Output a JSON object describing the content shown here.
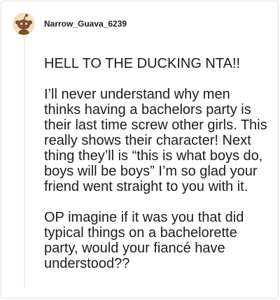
{
  "comment": {
    "username": "Narrow_Guava_6239",
    "avatar_icon": "reddit-snoo-avatar-icon",
    "paragraphs": [
      "HELL TO THE DUCKING NTA!!",
      "I’ll never understand why men thinks having a bachelors party is their last time screw other girls. This really shows their character! Next thing they’ll is “this is what boys do, boys will be boys” I’m so glad your friend went straight to you with it.",
      "OP imagine if it was you that did typical things on a bachelorette party, would your fiancé have understood??"
    ]
  },
  "colors": {
    "avatar_bg": "#f3dfbf",
    "avatar_figure": "#7a5230",
    "text": "#1c1c1c",
    "thread_line": "#edeff1",
    "border": "#e0e0e0"
  }
}
